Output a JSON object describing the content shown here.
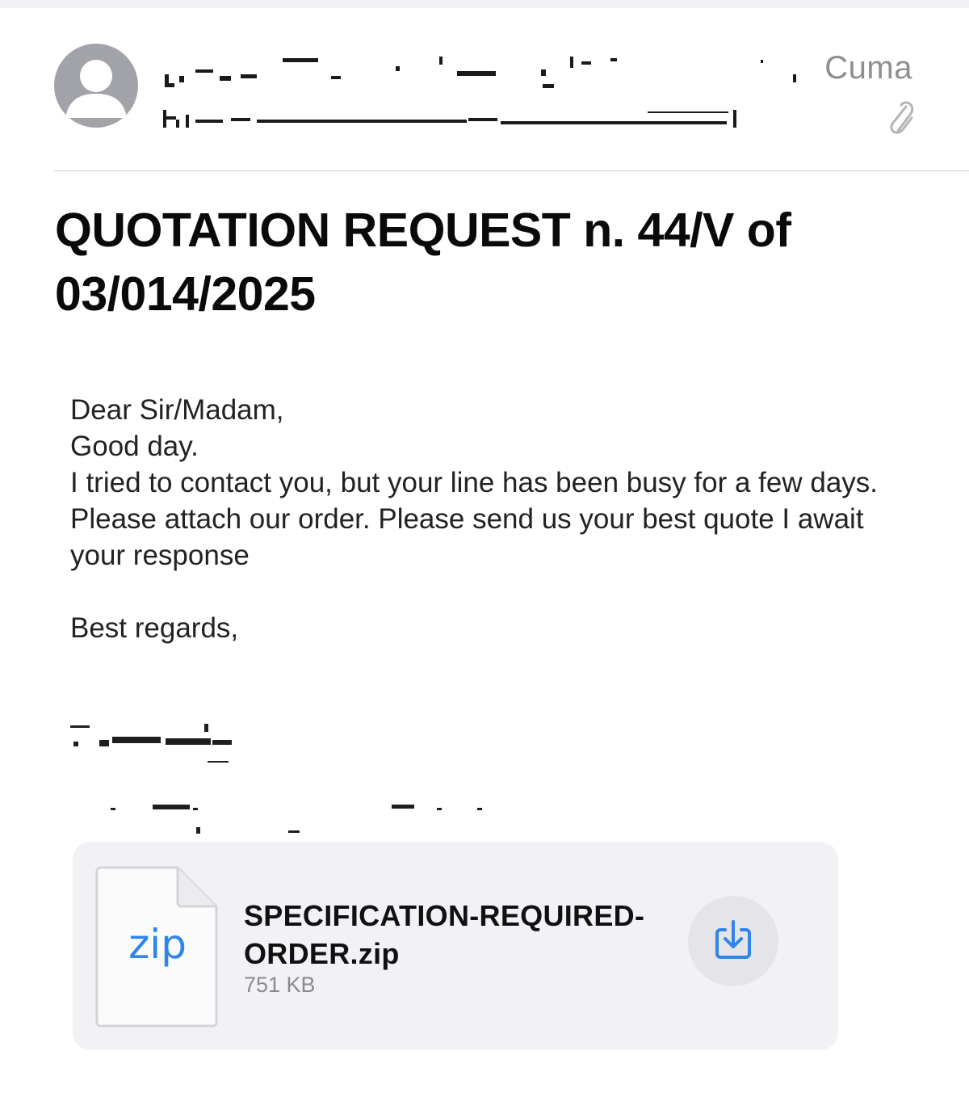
{
  "header": {
    "date_label": "Cuma",
    "attachment_icon": "paperclip-icon"
  },
  "message": {
    "subject": "QUOTATION REQUEST n. 44/V of 03/014/2025",
    "body": {
      "lines": [
        "Dear Sir/Madam,",
        "Good day.",
        "I tried to contact you, but your line has been busy for a few days.",
        "Please attach our order. Please send us your best quote I await your response"
      ],
      "closing": "Best regards,"
    }
  },
  "attachment": {
    "type_label": "zip",
    "file_name": "SPECIFICATION-REQUIRED-ORDER.zip",
    "file_size": "751 KB",
    "download_icon": "download-icon",
    "accent_color": "#2f86e8"
  }
}
